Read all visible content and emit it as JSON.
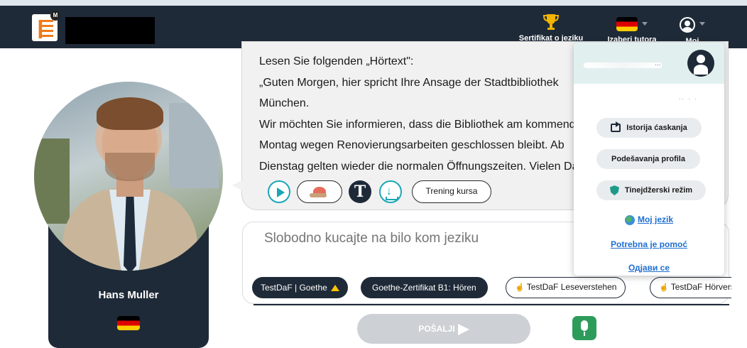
{
  "header": {
    "certificate_label": "Sertifikat o jeziku",
    "tutor_label": "Izaberi tutora",
    "me_label": "Moj",
    "logo_badge": "M"
  },
  "tutor": {
    "name": "Hans Muller"
  },
  "message": {
    "lines": [
      "Lesen Sie folgenden „Hörtext\":",
      "„Guten Morgen, hier spricht Ihre Ansage der Stadtbibliothek",
      "München.",
      "Wir möchten Sie informieren, dass die Bibliothek am kommenden",
      "Montag wegen Renovierungsarbeiten geschlossen bleibt. Ab",
      "Dienstag gelten wieder die normalen Öffnungszeiten. Vielen Dank"
    ],
    "t_button": "T",
    "download_glyph": "↓",
    "course_button": "Trening kursa"
  },
  "composer": {
    "placeholder": "Slobodno kucajte na bilo kom jeziku"
  },
  "chips": {
    "exam_selector": "TestDaF | Goethe",
    "chip2": "Goethe-Zertifikat B1: Hören",
    "chip3": "TestDaF Leseverstehen",
    "chip4": "TestDaF Hörverstehen",
    "hand_glyph": "☝"
  },
  "send": {
    "label": "POŠALJI"
  },
  "dropdown": {
    "name_dots": "...",
    "subtitle": ".. . .",
    "history": "Istorija ćaskanja",
    "profile": "Podešavanja profila",
    "teen_mode": "Tinejdžerski režim",
    "my_language": "Moj jezik",
    "help": "Potrebna je pomoć",
    "logout": "Одјави се"
  },
  "colors": {
    "navbar": "#1f2a38",
    "accent_teal": "#1aa6b7",
    "link_blue": "#1f6fd1",
    "mic_green": "#2d9c5a"
  }
}
